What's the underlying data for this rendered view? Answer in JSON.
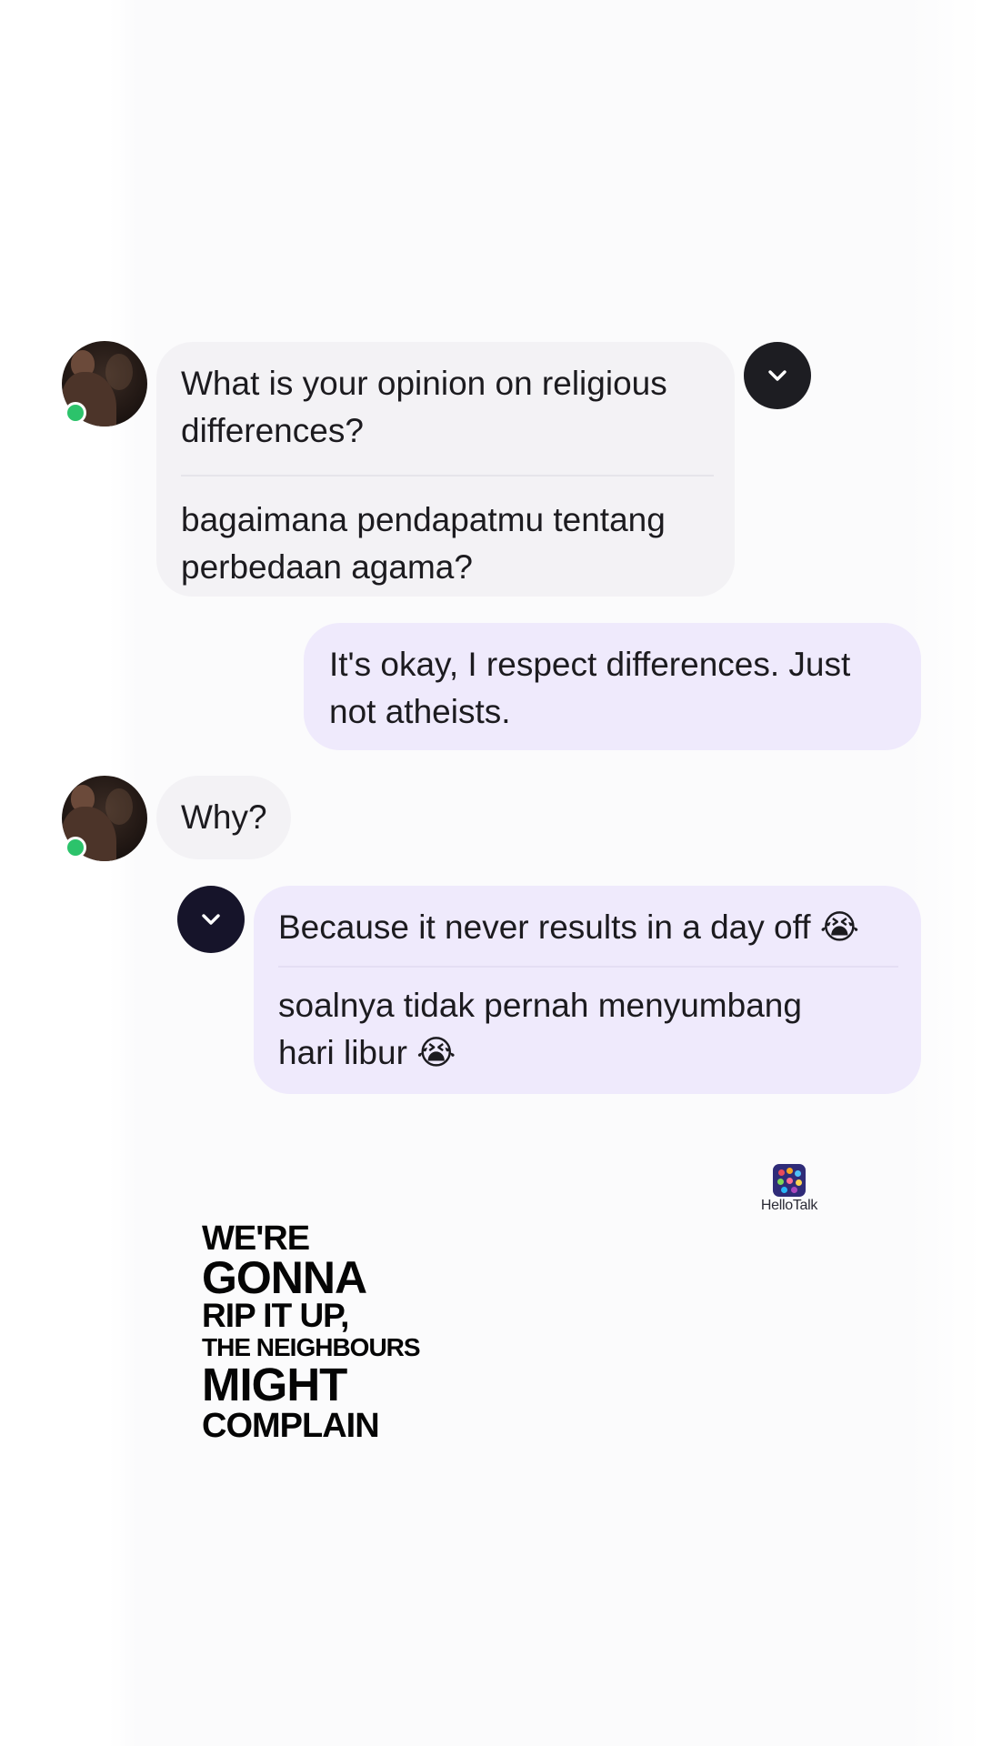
{
  "app": {
    "watermark": "HelloTalk",
    "accent_incoming_bubble": "#f3f2f5",
    "accent_outgoing_bubble": "#efeafc",
    "online_status_color": "#2cc36b",
    "button_color": "#1d1d22"
  },
  "messages": [
    {
      "sender": "partner",
      "text": "What is your opinion on religious differences?",
      "translation": "bagaimana pendapatmu tentang perbedaan agama?",
      "has_avatar": true,
      "action_icon": "chevron-down-icon"
    },
    {
      "sender": "me",
      "text": "It's okay, I respect differences. Just not atheists."
    },
    {
      "sender": "partner",
      "text": "Why?",
      "has_avatar": true
    },
    {
      "sender": "me",
      "text": "Because it never results in a day off 😭",
      "translation": "soalnya tidak pernah menyumbang hari libur 😭",
      "action_icon": "chevron-down-icon"
    }
  ],
  "lyrics": [
    "WE'RE",
    "GONNA",
    "RIP IT UP,",
    "THE NEIGHBOURS",
    "MIGHT",
    "COMPLAIN"
  ]
}
